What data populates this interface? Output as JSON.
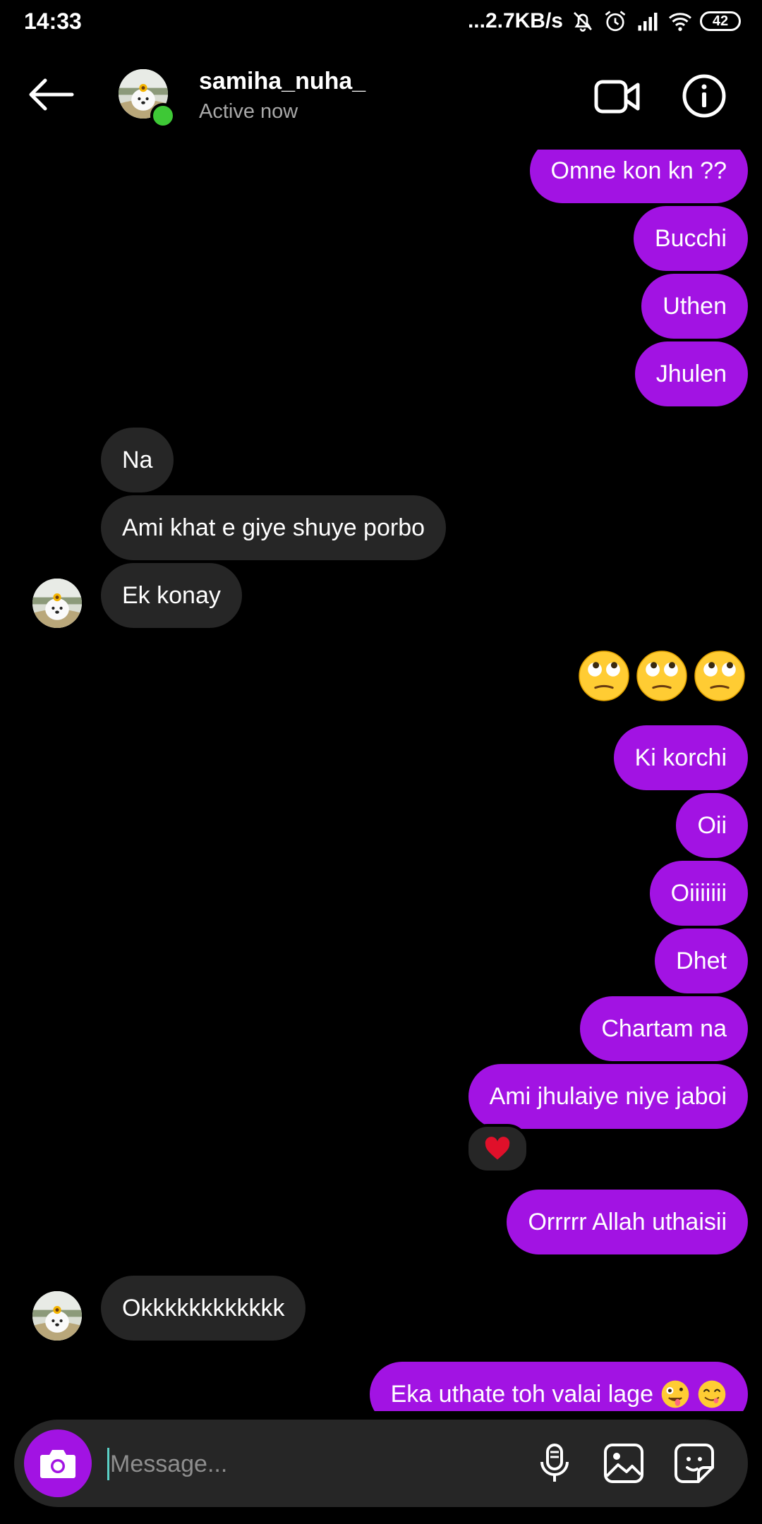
{
  "status_bar": {
    "time": "14:33",
    "network_speed": "...2.7KB/s",
    "battery": "42",
    "icons": [
      "mute-bell-icon",
      "alarm-icon",
      "signal-icon",
      "wifi-icon",
      "battery-icon"
    ]
  },
  "header": {
    "username": "samiha_nuha_",
    "status": "Active now",
    "online": true,
    "icons": [
      "back-arrow-icon",
      "video-call-icon",
      "info-icon"
    ]
  },
  "messages": [
    {
      "from": "me",
      "text": "Omne kon kn ??"
    },
    {
      "from": "me",
      "text": "Bucchi"
    },
    {
      "from": "me",
      "text": "Uthen"
    },
    {
      "from": "me",
      "text": "Jhulen"
    },
    {
      "from": "them",
      "text": "Na"
    },
    {
      "from": "them",
      "text": "Ami khat e giye shuye porbo"
    },
    {
      "from": "them",
      "text": "Ek konay"
    },
    {
      "from": "me",
      "emoji": "face-with-rolling-eyes x3"
    },
    {
      "from": "me",
      "text": "Ki korchi"
    },
    {
      "from": "me",
      "text": "Oii"
    },
    {
      "from": "me",
      "text": "Oiiiiiii"
    },
    {
      "from": "me",
      "text": "Dhet"
    },
    {
      "from": "me",
      "text": "Chartam na"
    },
    {
      "from": "me",
      "text": "Ami jhulaiye niye jaboi",
      "reaction": "❤️"
    },
    {
      "from": "me",
      "text": "Orrrrr Allah uthaisii"
    },
    {
      "from": "them",
      "text": "Okkkkkkkkkkkk"
    },
    {
      "from": "me",
      "text": "Eka uthate toh valai lage",
      "emoji": "zany-face, savoring-food-face"
    }
  ],
  "composer": {
    "placeholder": "Message...",
    "icons": [
      "camera-icon",
      "microphone-icon",
      "gallery-icon",
      "sticker-icon"
    ]
  },
  "colors": {
    "background": "#000000",
    "sent_bubble": "#a213e3",
    "received_bubble": "#262626",
    "online_dot": "#3ec836",
    "secondary_text": "#a8a8a8"
  }
}
